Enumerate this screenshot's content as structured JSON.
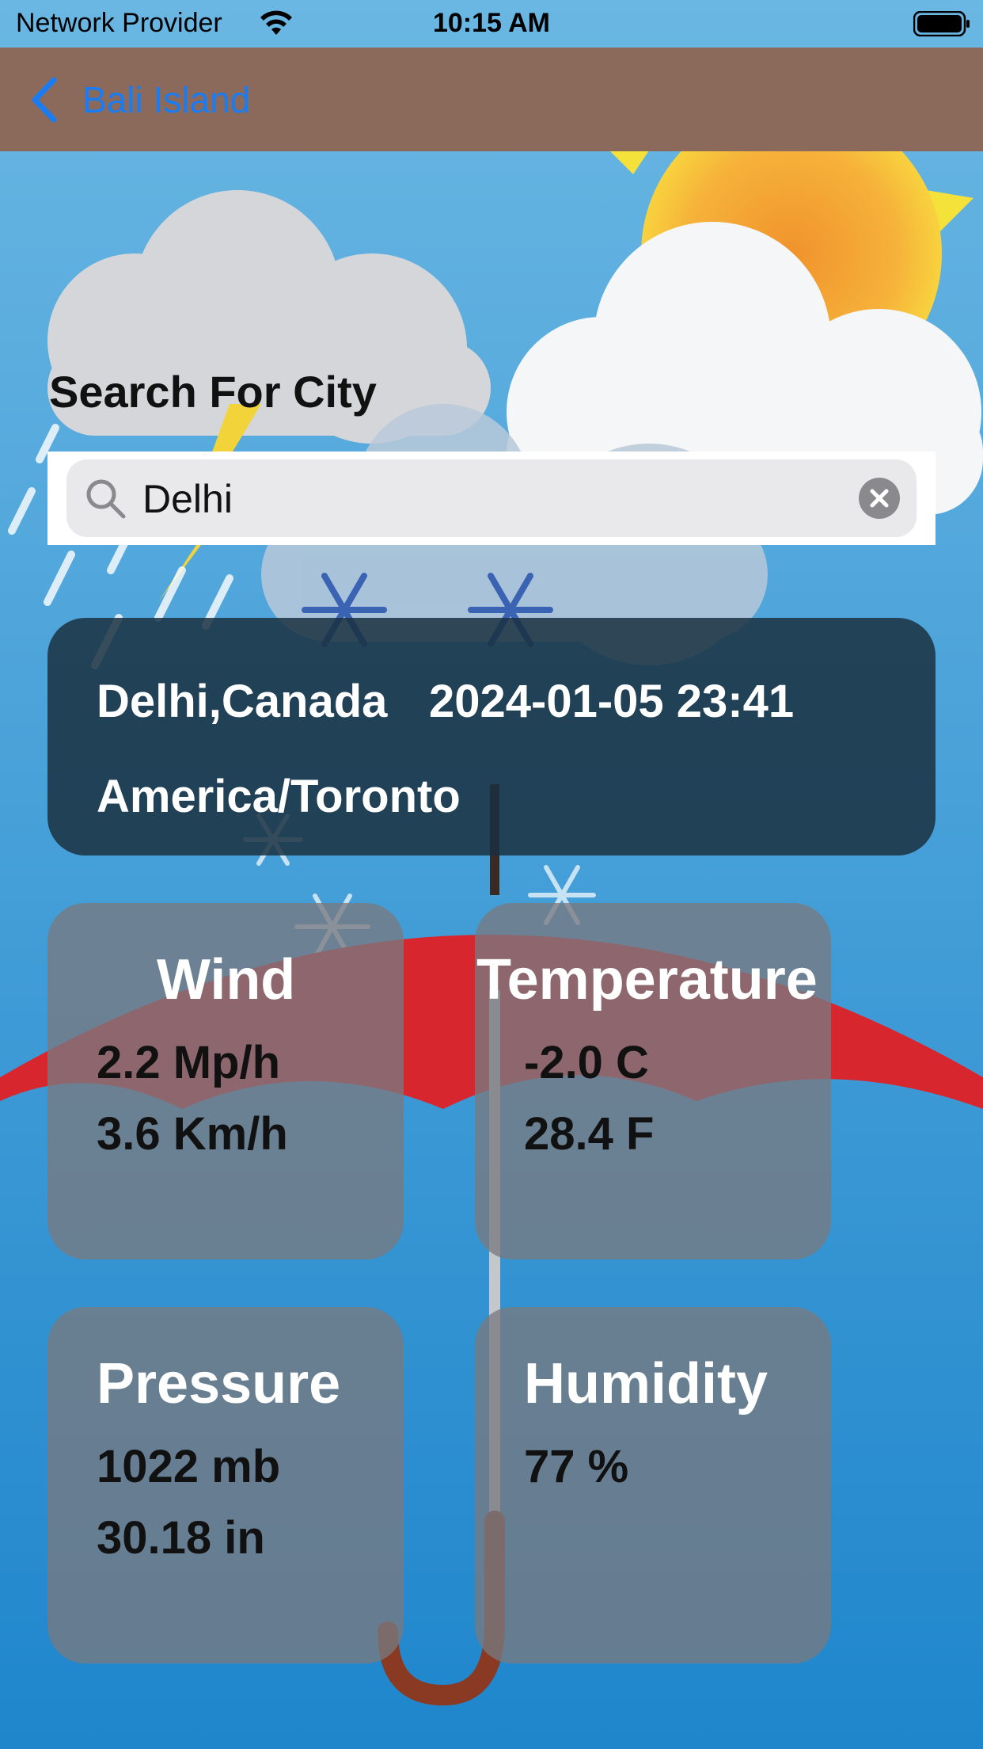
{
  "status_bar": {
    "carrier": "Network Provider",
    "time": "10:15 AM"
  },
  "nav": {
    "back_label": "Bali Island"
  },
  "search": {
    "title": "Search For City",
    "value": "Delhi"
  },
  "location": {
    "city": "Delhi,Canada",
    "datetime": "2024-01-05 23:41",
    "timezone": "America/Toronto"
  },
  "wind": {
    "title": "Wind",
    "mph": "2.2 Mp/h",
    "kmh": "3.6 Km/h"
  },
  "temperature": {
    "title": "Temperature",
    "celsius": "-2.0 C",
    "fahrenheit": "28.4 F"
  },
  "pressure": {
    "title": "Pressure",
    "mb": "1022 mb",
    "inches": "30.18 in"
  },
  "humidity": {
    "title": "Humidity",
    "percent": "77 %"
  },
  "icons": {
    "back": "chevron-left-icon",
    "search": "search-icon",
    "clear": "clear-circle-icon",
    "wifi": "wifi-icon",
    "battery": "battery-icon"
  },
  "colors": {
    "nav_bar": "#8b6a5c",
    "accent": "#1a7cf2",
    "sky": "#2b93d4"
  }
}
